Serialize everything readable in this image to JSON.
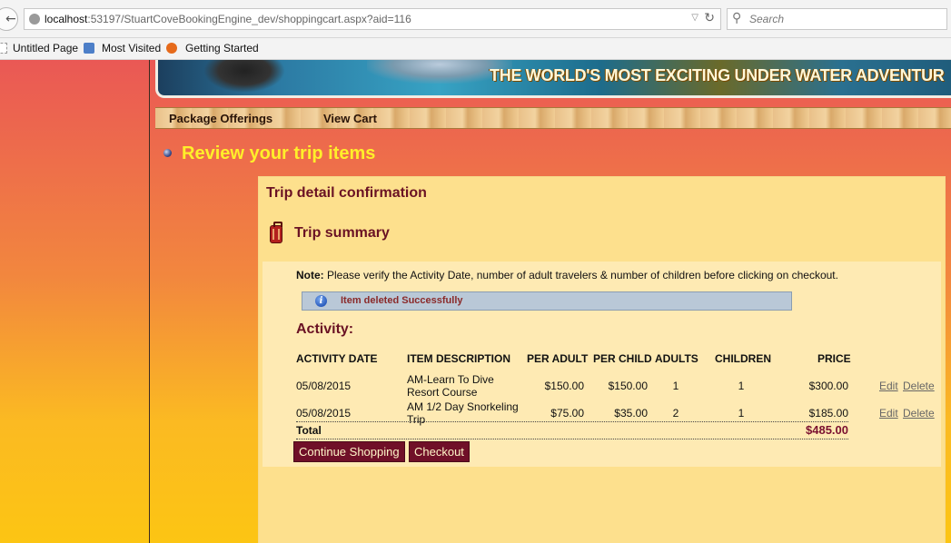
{
  "browser": {
    "url_host": "localhost",
    "url_rest": ":53197/StuartCoveBookingEngine_dev/shoppingcart.aspx?aid=116",
    "search_placeholder": "Search",
    "bookmarks": [
      "Untitled Page",
      "Most Visited",
      "Getting Started"
    ]
  },
  "banner": {
    "slogan": "THE WORLD'S MOST EXCITING UNDER WATER ADVENTUR"
  },
  "nav": {
    "items": [
      "Package Offerings",
      "View Cart"
    ]
  },
  "page_title": "Review your trip items",
  "panel": {
    "title": "Trip detail confirmation",
    "summary_title": "Trip summary",
    "note_label": "Note:",
    "note_text": "Please verify the Activity Date, number of adult travelers & number of children before clicking on checkout.",
    "message": "Item deleted Successfully",
    "activity_heading": "Activity:"
  },
  "table": {
    "headers": [
      "ACTIVITY DATE",
      "ITEM DESCRIPTION",
      "PER ADULT",
      "PER CHILD",
      "ADULTS",
      "CHILDREN",
      "PRICE"
    ],
    "rows": [
      {
        "date": "05/08/2015",
        "description": "AM-Learn To Dive Resort Course",
        "per_adult": "$150.00",
        "per_child": "$150.00",
        "adults": "1",
        "children": "1",
        "price": "$300.00",
        "edit": "Edit",
        "delete": "Delete"
      },
      {
        "date": "05/08/2015",
        "description": "AM 1/2 Day Snorkeling Trip",
        "per_adult": "$75.00",
        "per_child": "$35.00",
        "adults": "2",
        "children": "1",
        "price": "$185.00",
        "edit": "Edit",
        "delete": "Delete"
      }
    ],
    "total_label": "Total",
    "total_value": "$485.00"
  },
  "buttons": {
    "continue_shopping": "Continue Shopping",
    "checkout": "Checkout"
  }
}
